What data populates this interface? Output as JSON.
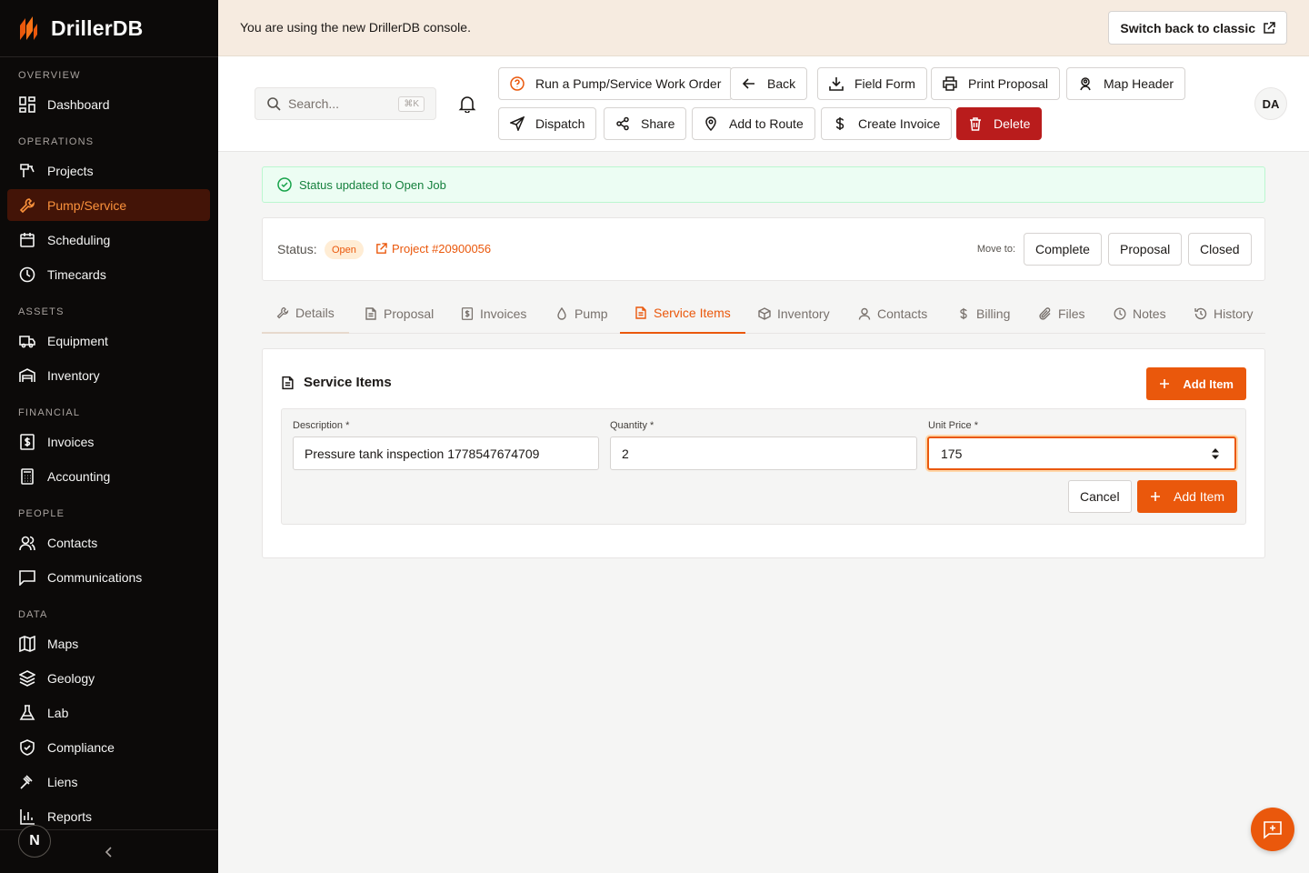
{
  "brand": {
    "name": "DrillerDB",
    "logo_icon": "driller-logo-icon",
    "accent": "#ea580c"
  },
  "sidebar": {
    "sections": [
      {
        "label": "OVERVIEW",
        "items": [
          {
            "label": "Dashboard",
            "icon": "dashboard-icon"
          }
        ]
      },
      {
        "label": "OPERATIONS",
        "items": [
          {
            "label": "Projects",
            "icon": "drill-icon"
          },
          {
            "label": "Pump/Service",
            "icon": "wrench-icon",
            "active": true
          },
          {
            "label": "Scheduling",
            "icon": "calendar-icon"
          },
          {
            "label": "Timecards",
            "icon": "clock-icon"
          }
        ]
      },
      {
        "label": "ASSETS",
        "items": [
          {
            "label": "Equipment",
            "icon": "truck-icon"
          },
          {
            "label": "Inventory",
            "icon": "warehouse-icon"
          }
        ]
      },
      {
        "label": "FINANCIAL",
        "items": [
          {
            "label": "Invoices",
            "icon": "invoice-icon"
          },
          {
            "label": "Accounting",
            "icon": "calculator-icon"
          }
        ]
      },
      {
        "label": "PEOPLE",
        "items": [
          {
            "label": "Contacts",
            "icon": "users-icon"
          },
          {
            "label": "Communications",
            "icon": "message-icon"
          }
        ]
      },
      {
        "label": "DATA",
        "items": [
          {
            "label": "Maps",
            "icon": "map-icon"
          },
          {
            "label": "Geology",
            "icon": "layers-icon"
          },
          {
            "label": "Lab",
            "icon": "flask-icon"
          },
          {
            "label": "Compliance",
            "icon": "shield-icon"
          },
          {
            "label": "Liens",
            "icon": "gavel-icon"
          },
          {
            "label": "Reports",
            "icon": "bar-chart-icon"
          }
        ]
      }
    ],
    "footer": {
      "avatar_initial": "N"
    }
  },
  "banner": {
    "text": "You are using the new DrillerDB console.",
    "button": "Switch back to classic"
  },
  "header": {
    "search_placeholder": "Search...",
    "shortcut": "⌘K",
    "user_initials": "DA",
    "actions": [
      {
        "label": "Run a Pump/Service Work Order",
        "icon": "help-circle-icon"
      },
      {
        "label": "Back",
        "icon": "arrow-left-icon"
      },
      {
        "label": "Field Form",
        "icon": "download-icon"
      },
      {
        "label": "Print Proposal",
        "icon": "printer-icon"
      },
      {
        "label": "Map Header",
        "icon": "map-pin-user-icon"
      },
      {
        "label": "Dispatch",
        "icon": "send-icon"
      },
      {
        "label": "Share",
        "icon": "share-icon"
      },
      {
        "label": "Add to Route",
        "icon": "location-pin-icon"
      },
      {
        "label": "Create Invoice",
        "icon": "dollar-icon"
      },
      {
        "label": "Delete",
        "icon": "trash-icon"
      }
    ]
  },
  "alert": {
    "text": "Status updated to Open Job"
  },
  "status": {
    "label": "Status:",
    "badge": "Open",
    "project_link": "Project #20900056",
    "move_label": "Move to:",
    "move_options": [
      "Complete",
      "Proposal",
      "Closed"
    ]
  },
  "tabs": [
    {
      "label": "Details",
      "icon": "wrench-icon"
    },
    {
      "label": "Proposal",
      "icon": "file-icon"
    },
    {
      "label": "Invoices",
      "icon": "invoice-icon"
    },
    {
      "label": "Pump",
      "icon": "droplet-icon"
    },
    {
      "label": "Service Items",
      "icon": "file-text-icon",
      "active": true
    },
    {
      "label": "Inventory",
      "icon": "package-icon"
    },
    {
      "label": "Contacts",
      "icon": "user-icon"
    },
    {
      "label": "Billing",
      "icon": "dollar-icon"
    },
    {
      "label": "Files",
      "icon": "paperclip-icon"
    },
    {
      "label": "Notes",
      "icon": "clock-icon"
    },
    {
      "label": "History",
      "icon": "history-icon"
    }
  ],
  "service_items": {
    "title": "Service Items",
    "add_button": "Add Item",
    "form": {
      "description_label": "Description *",
      "description_value": "Pressure tank inspection 1778547674709",
      "quantity_label": "Quantity *",
      "quantity_value": "2",
      "unit_price_label": "Unit Price *",
      "unit_price_value": "175",
      "cancel": "Cancel",
      "submit": "Add Item"
    }
  }
}
